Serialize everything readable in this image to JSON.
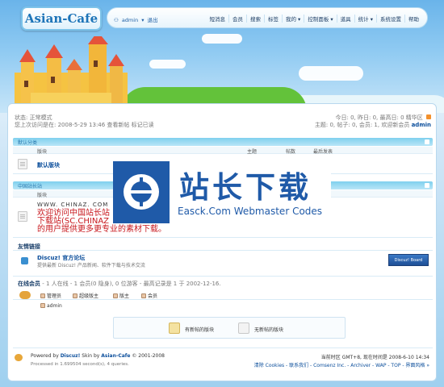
{
  "header": {
    "logo": "Asian-Cafe",
    "user": {
      "name": "admin",
      "logout": "退出"
    },
    "nav": [
      "短消息",
      "会员",
      "搜索",
      "标签",
      "我的",
      "控制面板",
      "道具",
      "统计",
      "系统设置",
      "帮助"
    ]
  },
  "status": {
    "line1": "状态: 正常模式",
    "line2": "您上次访问是在: 2008-5-29 13:46 查看新帖 标记已读",
    "right1": "今日: 0, 昨日: 0, 最高日: 0  精华区",
    "right2": "主题: 0, 帖子: 0, 会员: 1, 欢迎新会员",
    "right2_user": "admin"
  },
  "category1": {
    "title": "默认分类",
    "headers": [
      "版块",
      "主题",
      "帖数",
      "最后发表"
    ],
    "forum": "默认版块"
  },
  "category2": {
    "title": "中国站长站",
    "header": "版块",
    "intro_line1": "WWW. CHINAZ. COM",
    "intro_line2": "欢迎访问中国站长站",
    "intro_line3": "下载站(SC.CHINAZ",
    "intro_line4": "的用户提供更多更专业的素材下载。"
  },
  "links": {
    "title": "友情链接",
    "name": "Discuz! 官方论坛",
    "desc": "提供最新 Discuz! 产品新闻、软件下载与技术交流",
    "badge": "Discuz! Board"
  },
  "online": {
    "title": "在线会员",
    "summary": "- 1 人在线 - 1 会员(0 隐身), 0 位游客 - 最高记录是 1 于 2002-12-16.",
    "groups": [
      "管理员",
      "超级版主",
      "版主",
      "会员"
    ],
    "user": "admin"
  },
  "legend": {
    "new": "有新帖的版块",
    "nonew": "无新帖的版块"
  },
  "footer": {
    "powered_prefix": "Powered by",
    "powered_brand": "Discuz!",
    "skin_prefix": "Skin by",
    "skin_brand": "Asian-Cafe",
    "copyright": "© 2001-2008",
    "processed": "Processed in 1.699504 second(s), 4 queries.",
    "time": "当前时区  GMT+8, 现在时间是  2008-6-10 14:34",
    "links": "清除 Cookies - 联系我们 - Comsenz Inc. - Archiver - WAP - TOP - 界面风格 »"
  },
  "watermark": {
    "cn": "站长下载",
    "en": "Easck.Com Webmaster Codes"
  },
  "colors": {
    "accent": "#1d74b8",
    "bar": "#7fd0ee",
    "watermark": "#1f5aa8",
    "red_text": "#c8181e"
  }
}
